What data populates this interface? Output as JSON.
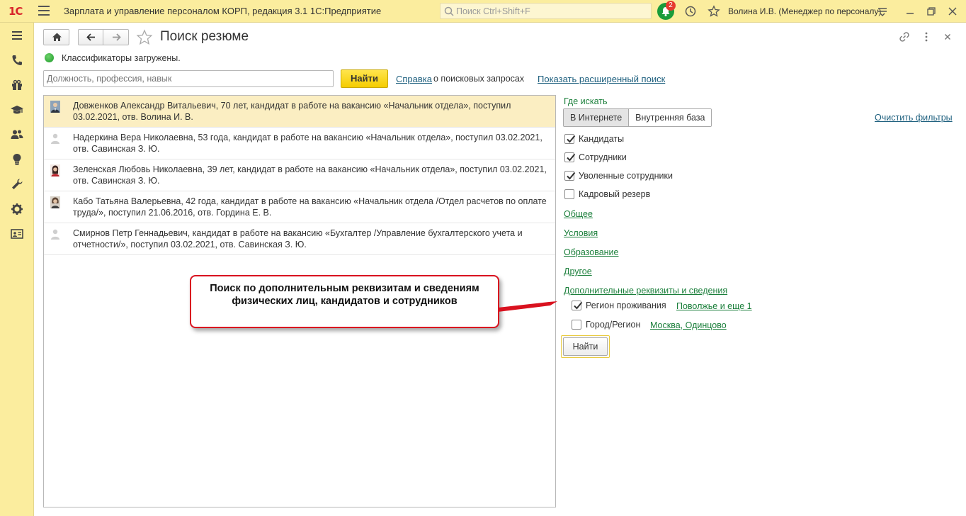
{
  "titlebar": {
    "logo": "1С",
    "app_title": "Зарплата и управление персоналом КОРП, редакция 3.1 1С:Предприятие",
    "search_placeholder": "Поиск Ctrl+Shift+F",
    "notification_count": "2",
    "user": "Волина И.В. (Менеджер по персоналу)"
  },
  "sidebar": {
    "items": [
      "menu-icon",
      "phone-icon",
      "gift-icon",
      "graduation-cap-icon",
      "people-icon",
      "lightbulb-icon",
      "wrench-icon",
      "gear-icon",
      "id-card-icon"
    ]
  },
  "header": {
    "title": "Поиск резюме"
  },
  "status": {
    "text": "Классификаторы загружены.",
    "color": "#2aa33a"
  },
  "search": {
    "placeholder": "Должность, профессия, навык",
    "find_label": "Найти",
    "help_link": "Справка",
    "help_suffix": "о поисковых запросах",
    "advanced_link": "Показать расширенный поиск"
  },
  "results": [
    {
      "text": "Довженков Александр Витальевич, 70 лет, кандидат в работе на вакансию «Начальник отдела», поступил 03.02.2021, отв. Волина И. В.",
      "avatar": "photo-man"
    },
    {
      "text": "Надеркина Вера Николаевна, 53 года, кандидат в работе на вакансию «Начальник отдела», поступил 03.02.2021, отв. Савинская З. Ю.",
      "avatar": "placeholder"
    },
    {
      "text": "Зеленская Любовь Николаевна, 39 лет, кандидат в работе на вакансию «Начальник отдела», поступил 03.02.2021, отв. Савинская З. Ю.",
      "avatar": "photo-woman"
    },
    {
      "text": "Кабо Татьяна Валерьевна, 42 года, кандидат в работе на вакансию «Начальник отдела /Отдел расчетов по оплате труда/», поступил 21.06.2016, отв. Гордина Е. В.",
      "avatar": "photo-woman2"
    },
    {
      "text": "Смирнов Петр Геннадьевич, кандидат в работе на вакансию «Бухгалтер /Управление бухгалтерского учета и отчетности/», поступил 03.02.2021, отв. Савинская З. Ю.",
      "avatar": "placeholder"
    }
  ],
  "filters": {
    "where_label": "Где искать",
    "toggle_internet": "В Интернете",
    "toggle_internal": "Внутренняя база",
    "clear_filters": "Очистить фильтры",
    "checkboxes": [
      {
        "label": "Кандидаты",
        "checked": true
      },
      {
        "label": "Сотрудники",
        "checked": true
      },
      {
        "label": "Уволенные сотрудники",
        "checked": true
      },
      {
        "label": "Кадровый резерв",
        "checked": false
      }
    ],
    "sections": [
      "Общее",
      "Условия",
      "Образование",
      "Другое",
      "Дополнительные реквизиты и сведения"
    ],
    "extra": [
      {
        "label": "Регион проживания",
        "checked": true,
        "value": "Поволжье и еще 1"
      },
      {
        "label": "Город/Регион",
        "checked": false,
        "value": "Москва, Одинцово"
      }
    ],
    "find_label": "Найти"
  },
  "callout": {
    "line1": "Поиск по дополнительным реквизитам и сведениям",
    "line2": "физических лиц, кандидатов и сотрудников",
    "border_color": "#d9121f"
  }
}
